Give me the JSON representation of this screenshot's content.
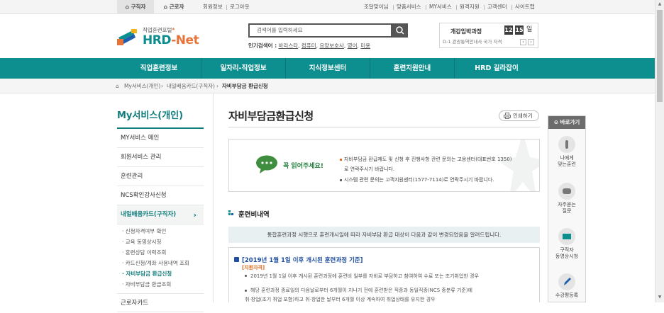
{
  "topbar": {
    "tabs": [
      "구직자",
      "근로자"
    ],
    "left_links": [
      "회원정보",
      "로그아웃"
    ],
    "right_links": [
      "조달맞이님",
      "맞춤서비스",
      "MY서비스",
      "원격지원",
      "고객센터",
      "사이트맵"
    ]
  },
  "header": {
    "logo_sub": "직업훈련포털",
    "logo_main_a": "HRD",
    "logo_main_b": "-Net",
    "search_placeholder": "검색어를 입력하세요",
    "popular_label": "인기검색어 :",
    "popular_keywords": [
      "바리스타",
      "컴퓨터",
      "요양보호사",
      "영어",
      "미용"
    ],
    "schedule_title": "개강임박과정",
    "schedule_month": "12",
    "schedule_day": "15",
    "schedule_unit": "일",
    "schedule_text": "D-1 관광통역안내사 국가 자격"
  },
  "nav": [
    "직업훈련정보",
    "일자리-직업정보",
    "지식정보센터",
    "훈련지원안내",
    "HRD 길라잡이"
  ],
  "breadcrumb": [
    "My서비스(개인)",
    "내일배움카드(구직자)",
    "자비부담금 환급신청"
  ],
  "sidebar": {
    "title": "My서비스(개인)",
    "menus": [
      "MY서비스 메인",
      "회원서비스 관리",
      "훈련관리",
      "NCS확인강사신청",
      "내일배움카드(구직자)"
    ],
    "submenu": [
      "신청자격여부 확인",
      "교육 동영상시청",
      "훈련상담 이력조회",
      "카드신청/계좌 사용내역 조회",
      "자비부담금 환급신청",
      "자비부담금 환급조회"
    ],
    "more": "근로자카드"
  },
  "main": {
    "title": "자비부담금환급신청",
    "print_label": "인쇄하기",
    "notice_label": "꼭 읽어주세요!",
    "notice_line1": "자비부담금 환급제도 및 신청 후 진행사항 관련 문의는 고용센터(대표번호 1350)",
    "notice_line2": "로 연락주시기 바랍니다.",
    "notice_line3": "시스템 관련 문의는 고객지원센터(1577-7114)로 연락주시기 바랍니다.",
    "section_title": "훈련비내역",
    "info_bar": "통합훈련과정 시행으로 훈련개시일에 따라 자비부담 환급 대상이 다음과 같이 변경되었음을 알려드립니다.",
    "box_heading": "[2019년 1월 1일 이후 개시된 훈련과정 기준]",
    "box_sub": "[지원자격]",
    "box_p1": "2019년 1월 1일 이후 개시된 훈련과정에 훈련비 일부를 자비로 부담하고 참여하여 수료 또는 조기취업한 경우",
    "box_p2": "해당 훈련과정 종료일의 다음날로부터 6개월이 지나기 전에 훈련받은 직종과 동일직종(NCS 중분류 기준)에",
    "box_p3": "취·창업(조기 취업 포함)하고 취·창업한 날부터 6개월 이상 계속하여 취업상태를 유지한 경우"
  },
  "quick": {
    "head": "바로가기",
    "items": [
      "나에게\n맞는훈련",
      "자주묻는\n질문",
      "구직자\n동영상시청",
      "수강평등록"
    ]
  }
}
